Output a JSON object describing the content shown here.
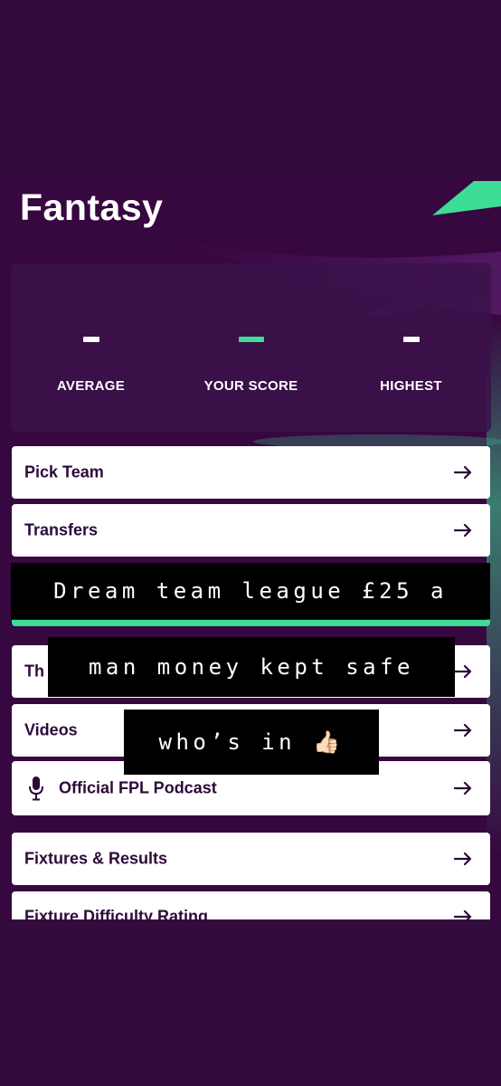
{
  "header": {
    "title": "Fantasy"
  },
  "scores": {
    "average": {
      "value": "–",
      "label": "AVERAGE"
    },
    "your_score": {
      "value": "–",
      "label": "YOUR SCORE"
    },
    "highest": {
      "value": "–",
      "label": "HIGHEST"
    }
  },
  "menu": {
    "items": [
      {
        "label": "Pick Team",
        "icon": "arrow-right-icon"
      },
      {
        "label": "Transfers",
        "icon": "arrow-right-icon"
      },
      {
        "label": "Th",
        "icon": "arrow-right-icon"
      },
      {
        "label": "Videos",
        "icon": "arrow-right-icon"
      },
      {
        "label": "Official FPL Podcast",
        "icon": "arrow-right-icon",
        "leading_icon": "microphone-icon"
      },
      {
        "label": "Fixtures & Results",
        "icon": "arrow-right-icon"
      },
      {
        "label": "Fixture Difficulty Rating",
        "icon": "arrow-right-icon"
      }
    ]
  },
  "overlay_captions": [
    "Dream team league £25 a",
    "man money kept safe",
    "who’s in 👍🏻"
  ],
  "colors": {
    "background": "#37073f",
    "panel": "#3a124a",
    "accent_green": "#3ddc97",
    "text_dark": "#2d0a3a"
  }
}
